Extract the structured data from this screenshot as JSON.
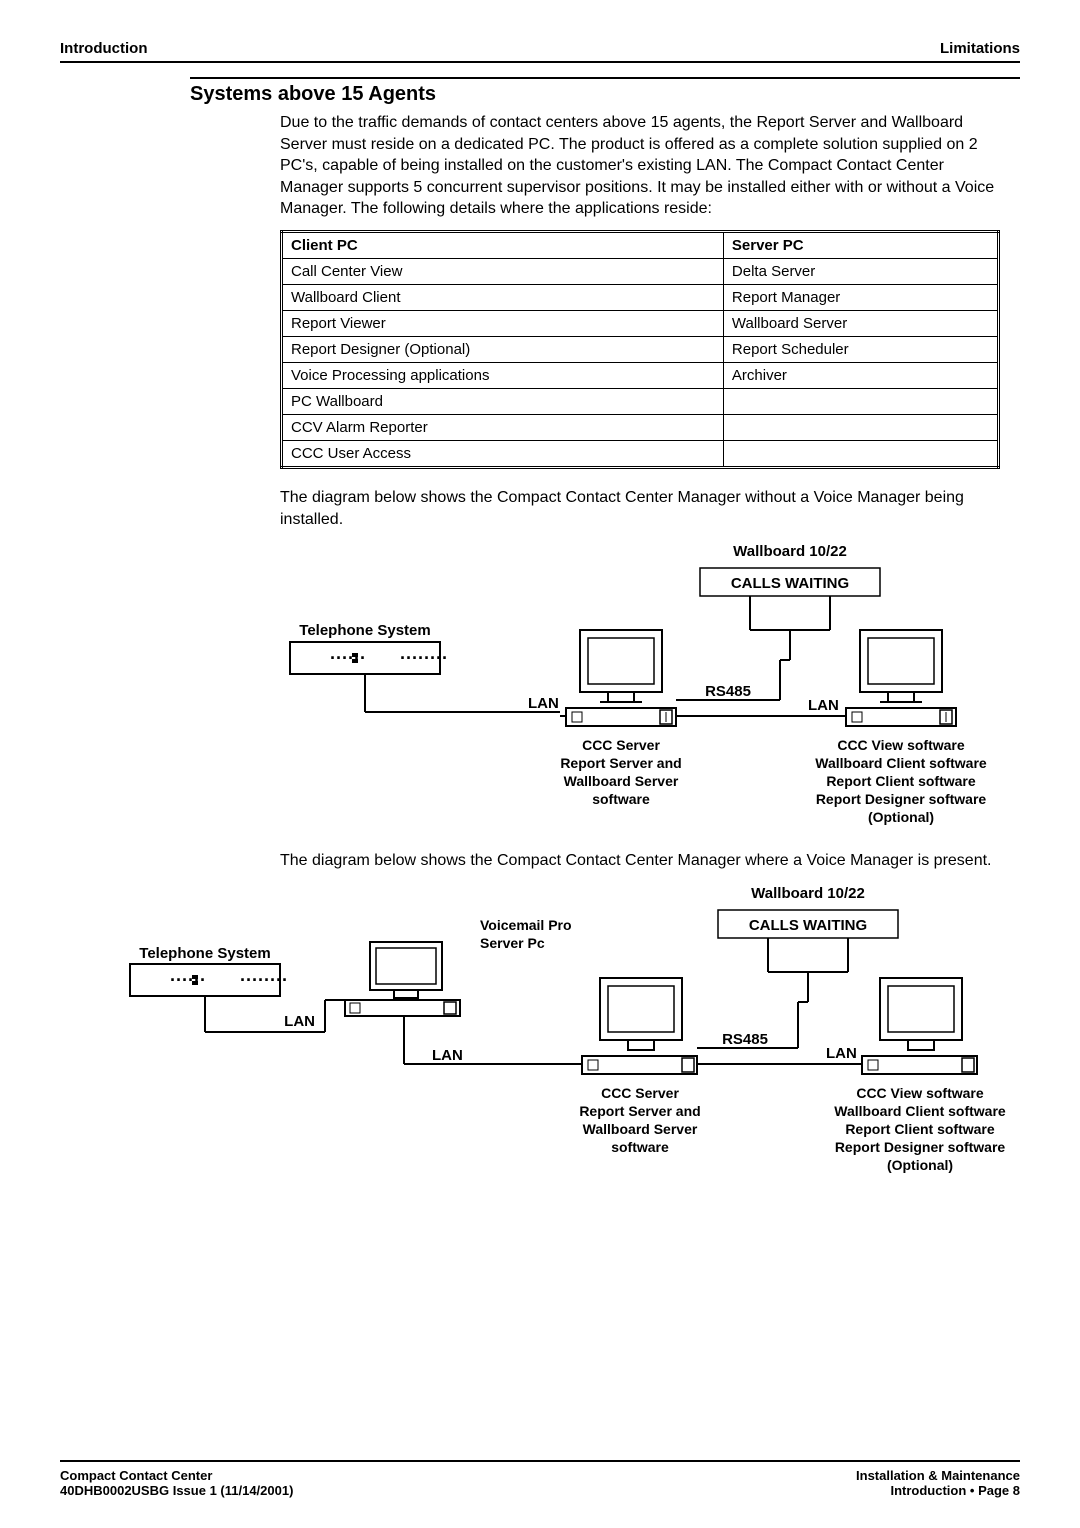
{
  "header": {
    "left": "Introduction",
    "right": "Limitations"
  },
  "section": {
    "title": "Systems above 15 Agents"
  },
  "para1": "Due to the traffic demands of contact centers above 15 agents, the Report Server and Wallboard Server must reside on a dedicated PC.  The product is offered as a complete solution supplied on 2 PC's, capable of being installed on the customer's existing LAN.  The Compact Contact Center Manager supports 5 concurrent supervisor positions.  It may be installed either with or without a Voice Manager.  The following details where the applications reside:",
  "table": {
    "headers": {
      "c1": "Client PC",
      "c2": "Server PC"
    },
    "rows": [
      {
        "c1": "Call Center View",
        "c2": "Delta Server"
      },
      {
        "c1": "Wallboard Client",
        "c2": "Report Manager"
      },
      {
        "c1": "Report Viewer",
        "c2": "Wallboard Server"
      },
      {
        "c1": "Report Designer (Optional)",
        "c2": "Report Scheduler"
      },
      {
        "c1": "Voice Processing applications",
        "c2": "Archiver"
      },
      {
        "c1": "PC Wallboard",
        "c2": ""
      },
      {
        "c1": "CCV Alarm Reporter",
        "c2": ""
      },
      {
        "c1": "CCC User Access",
        "c2": ""
      }
    ]
  },
  "para2": "The diagram below shows the Compact Contact Center Manager without a Voice Manager being installed.",
  "para3": "The diagram below shows the Compact Contact Center Manager where a Voice Manager is present.",
  "diagram1": {
    "wallboard_title": "Wallboard 10/22",
    "calls_waiting": "CALLS WAITING",
    "telephone_system": "Telephone System",
    "lan": "LAN",
    "rs485": "RS485",
    "ccc_server_l1": "CCC Server",
    "ccc_server_l2": "Report Server and",
    "ccc_server_l3": "Wallboard Server",
    "ccc_server_l4": "software",
    "ccc_view_l1": "CCC View software",
    "ccc_view_l2": "Wallboard Client software",
    "ccc_view_l3": "Report Client software",
    "ccc_view_l4": "Report Designer software",
    "ccc_view_l5": "(Optional)"
  },
  "diagram2": {
    "wallboard_title": "Wallboard 10/22",
    "calls_waiting": "CALLS WAITING",
    "telephone_system": "Telephone System",
    "voicemail_l1": "Voicemail Pro",
    "voicemail_l2": "Server Pc",
    "lan": "LAN",
    "rs485": "RS485",
    "ccc_server_l1": "CCC Server",
    "ccc_server_l2": "Report Server and",
    "ccc_server_l3": "Wallboard Server",
    "ccc_server_l4": "software",
    "ccc_view_l1": "CCC View software",
    "ccc_view_l2": "Wallboard Client software",
    "ccc_view_l3": "Report Client software",
    "ccc_view_l4": "Report Designer software",
    "ccc_view_l5": "(Optional)"
  },
  "footer": {
    "left1": "Compact Contact Center",
    "left2": "40DHB0002USBG Issue 1 (11/14/2001)",
    "right1": "Installation & Maintenance",
    "right2": "Introduction • Page 8"
  }
}
